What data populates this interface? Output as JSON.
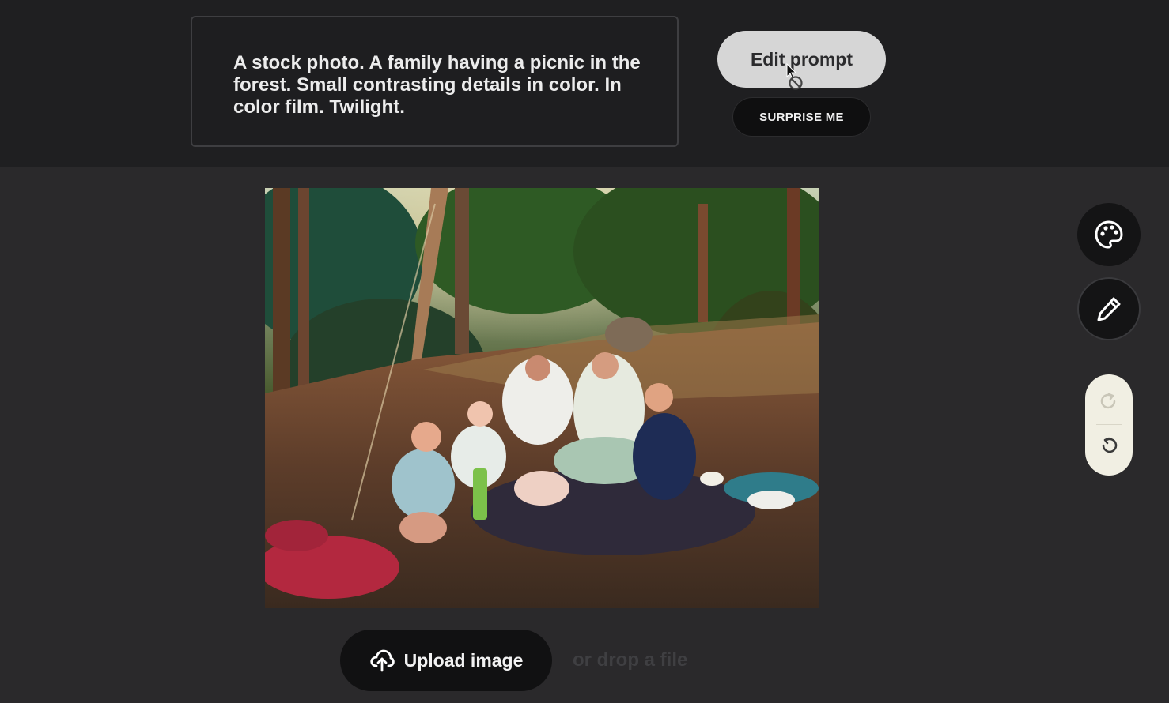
{
  "prompt": {
    "text": "A stock photo. A family having a picnic in the forest. Small contrasting details in color. In color film. Twilight."
  },
  "buttons": {
    "edit_prompt": "Edit prompt",
    "surprise_me": "SURPRISE ME",
    "upload_image": "Upload image"
  },
  "upload": {
    "drop_hint": "or drop a file"
  },
  "tools": [
    {
      "icon": "palette-icon"
    },
    {
      "icon": "pencil-icon"
    }
  ],
  "history": [
    {
      "icon": "redo-icon"
    },
    {
      "icon": "undo-icon"
    }
  ],
  "colors": {
    "page_background": "#2a292b",
    "top_bar": "#1f1f21",
    "edit_button": "#d6d6d6",
    "dark_button": "#111112",
    "history_pill": "#f1efe3"
  }
}
